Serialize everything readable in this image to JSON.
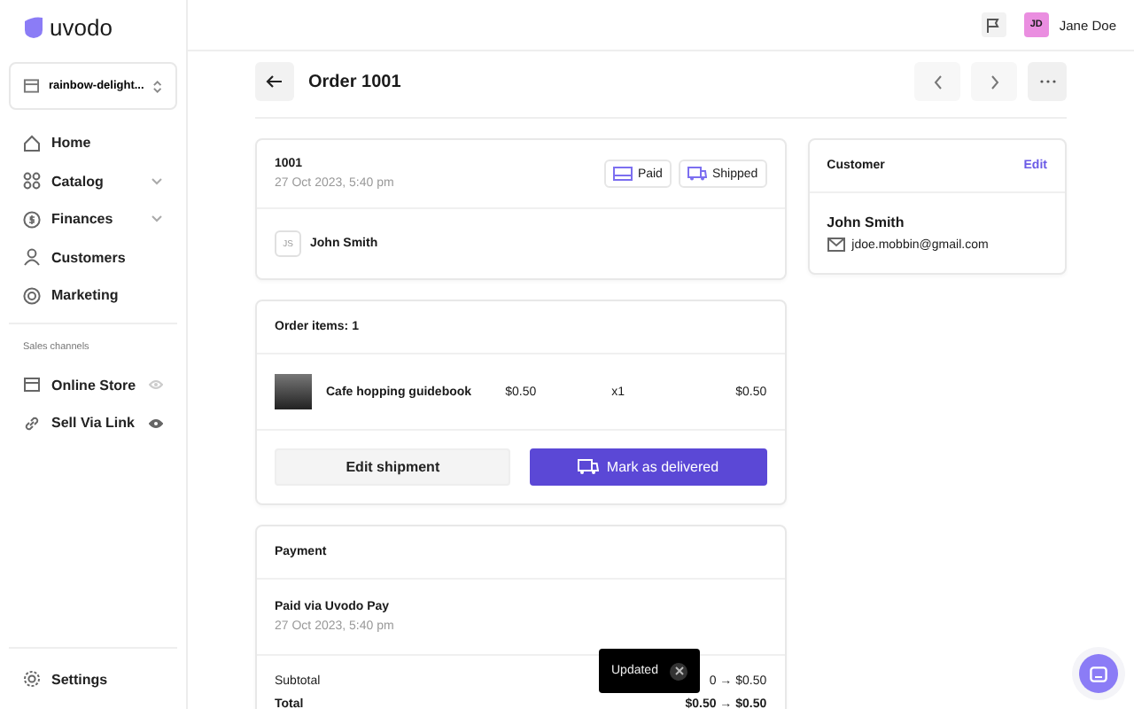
{
  "logo": {
    "text": "uvodo"
  },
  "store_switcher": {
    "value": "rainbow-delight..."
  },
  "nav": [
    {
      "label": "Home",
      "expandable": false
    },
    {
      "label": "Catalog",
      "expandable": true
    },
    {
      "label": "Finances",
      "expandable": true
    },
    {
      "label": "Customers",
      "expandable": false
    },
    {
      "label": "Marketing",
      "expandable": false
    }
  ],
  "sales_channels": {
    "heading": "Sales channels",
    "items": [
      {
        "label": "Online Store",
        "visible": false
      },
      {
        "label": "Sell Via Link",
        "visible": true
      }
    ]
  },
  "settings": {
    "label": "Settings"
  },
  "topbar": {
    "user": {
      "initials": "JD",
      "name": "Jane Doe"
    }
  },
  "page": {
    "title": "Order 1001"
  },
  "order": {
    "number": "1001",
    "date": "27 Oct 2023, 5:40 pm",
    "badges": [
      {
        "label": "Paid",
        "kind": "card"
      },
      {
        "label": "Shipped",
        "kind": "truck"
      }
    ],
    "customer": {
      "initials": "JS",
      "name": "John Smith"
    }
  },
  "items": {
    "title": "Order items: 1",
    "rows": [
      {
        "name": "Cafe hopping guidebook",
        "price": "$0.50",
        "qty": "x1",
        "total": "$0.50"
      }
    ],
    "buttons": [
      {
        "label": "Edit shipment",
        "kind": "secondary"
      },
      {
        "label": "Mark as delivered",
        "kind": "primary"
      }
    ]
  },
  "payment": {
    "title": "Payment",
    "method": "Paid via Uvodo Pay",
    "date": "27 Oct 2023, 5:40 pm",
    "lines": [
      {
        "label": "Subtotal",
        "value": "0 → $0.50",
        "bold": false
      },
      {
        "label": "Total",
        "value": "$0.50 → $0.50",
        "bold": true
      }
    ]
  },
  "customer_card": {
    "title": "Customer",
    "action": "Edit",
    "name": "John Smith",
    "email": "jdoe.mobbin@gmail.com"
  },
  "toast": {
    "text": "Updated"
  }
}
